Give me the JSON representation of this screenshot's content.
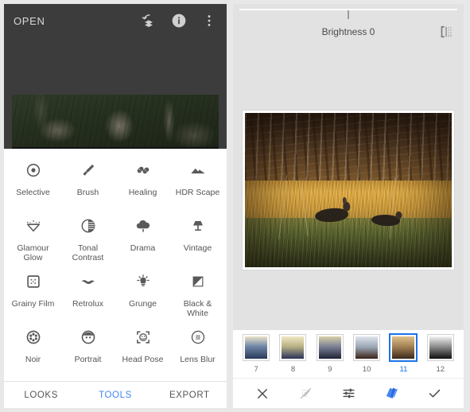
{
  "left_screen": {
    "topbar": {
      "open_label": "OPEN",
      "icons": [
        {
          "name": "revert-stack-icon",
          "label": "Revert"
        },
        {
          "name": "info-icon",
          "label": "Info"
        },
        {
          "name": "overflow-menu-icon",
          "label": "More"
        }
      ]
    },
    "tools": [
      {
        "label": "Selective",
        "icon": "selective-icon"
      },
      {
        "label": "Brush",
        "icon": "brush-icon"
      },
      {
        "label": "Healing",
        "icon": "healing-icon"
      },
      {
        "label": "HDR Scape",
        "icon": "hdr-scape-icon"
      },
      {
        "label": "Glamour Glow",
        "icon": "glamour-glow-icon"
      },
      {
        "label": "Tonal Contrast",
        "icon": "tonal-contrast-icon"
      },
      {
        "label": "Drama",
        "icon": "drama-icon"
      },
      {
        "label": "Vintage",
        "icon": "vintage-icon"
      },
      {
        "label": "Grainy Film",
        "icon": "grainy-film-icon"
      },
      {
        "label": "Retrolux",
        "icon": "retrolux-icon"
      },
      {
        "label": "Grunge",
        "icon": "grunge-icon"
      },
      {
        "label": "Black & White",
        "icon": "black-and-white-icon"
      },
      {
        "label": "Noir",
        "icon": "noir-icon"
      },
      {
        "label": "Portrait",
        "icon": "portrait-icon"
      },
      {
        "label": "Head Pose",
        "icon": "head-pose-icon"
      },
      {
        "label": "Lens Blur",
        "icon": "lens-blur-icon"
      },
      {
        "label": "",
        "icon": "vignette-icon"
      },
      {
        "label": "",
        "icon": "double-exposure-icon"
      },
      {
        "label": "",
        "icon": "text-icon"
      },
      {
        "label": "",
        "icon": "frames-icon"
      }
    ],
    "bottom_nav": [
      {
        "label": "LOOKS",
        "active": false
      },
      {
        "label": "TOOLS",
        "active": true
      },
      {
        "label": "EXPORT",
        "active": false
      }
    ]
  },
  "right_screen": {
    "adjustment": {
      "name": "Brightness",
      "value": "0",
      "display": "Brightness 0",
      "slider_position_percent": 50
    },
    "compare_icon": "compare-split-icon",
    "filters": [
      {
        "number": "7",
        "selected": false,
        "top": "#e8e2c8",
        "mid": "#6f86a8",
        "bottom": "#2b3a58"
      },
      {
        "number": "8",
        "selected": false,
        "top": "#efe7c2",
        "mid": "#b9b184",
        "bottom": "#2a3459"
      },
      {
        "number": "9",
        "selected": false,
        "top": "#d8cfa8",
        "mid": "#7d8296",
        "bottom": "#1f2336"
      },
      {
        "number": "10",
        "selected": false,
        "top": "#dfe4ea",
        "mid": "#9aa6b4",
        "bottom": "#3a2318"
      },
      {
        "number": "11",
        "selected": true,
        "top": "#e0c189",
        "mid": "#9c7a50",
        "bottom": "#3a2a1c"
      },
      {
        "number": "12",
        "selected": false,
        "top": "#f2f2f2",
        "mid": "#8d8d8d",
        "bottom": "#111111"
      }
    ],
    "toolbar": [
      {
        "name": "cancel-button",
        "icon": "close-icon",
        "state": "normal"
      },
      {
        "name": "masking-button",
        "icon": "masking-brush-off-icon",
        "state": "disabled"
      },
      {
        "name": "adjust-button",
        "icon": "sliders-icon",
        "state": "normal"
      },
      {
        "name": "looks-button",
        "icon": "stack-looks-icon",
        "state": "accent"
      },
      {
        "name": "apply-button",
        "icon": "check-icon",
        "state": "normal"
      }
    ]
  },
  "colors": {
    "accent_blue": "#4285f4",
    "selected_blue": "#1a73e8",
    "editor_dark": "#3c3c3c",
    "page_bg": "#e8e8e8"
  }
}
